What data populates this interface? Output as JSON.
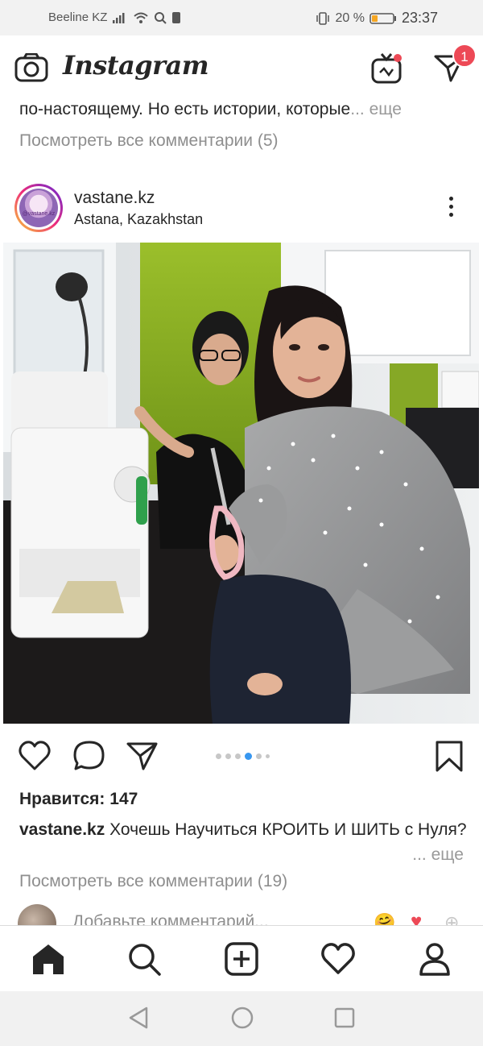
{
  "status_bar": {
    "carrier": "Beeline KZ",
    "battery_percent": "20 %",
    "time": "23:37"
  },
  "header": {
    "app_name": "Instagram",
    "dm_badge_count": "1"
  },
  "previous_post": {
    "caption_tail": "по-настоящему. Но есть истории, которые",
    "more_label": "... еще",
    "view_comments": "Посмотреть все комментарии (5)"
  },
  "post": {
    "username": "vastane.kz",
    "location": "Astana, Kazakhstan",
    "avatar_text": "@vastane.kz",
    "carousel": {
      "count": 6,
      "active_index": 3
    },
    "likes": "Нравится: 147",
    "caption_username": "vastane.kz",
    "caption_text": "Хочешь Научиться  КРОИТЬ И ШИТЬ с Нуля?",
    "more_label": "... еще",
    "view_comments": "Посмотреть все комментарии (19)",
    "add_comment_placeholder": "Добавьте комментарий..."
  },
  "icons": {
    "camera": "camera-icon",
    "igtv": "igtv-icon",
    "direct": "direct-message-icon",
    "more": "more-options-icon",
    "like": "heart-icon",
    "comment": "comment-icon",
    "share": "share-icon",
    "save": "bookmark-icon",
    "home": "home-icon",
    "search": "search-icon",
    "new_post": "new-post-icon",
    "activity": "activity-heart-icon",
    "profile": "profile-icon",
    "back": "back-triangle-icon",
    "home_nav": "home-circle-icon",
    "recents": "recents-square-icon"
  },
  "colors": {
    "notification_badge": "#ed4956",
    "carousel_active": "#3897f0",
    "secondary_text": "#8e8e8e"
  }
}
